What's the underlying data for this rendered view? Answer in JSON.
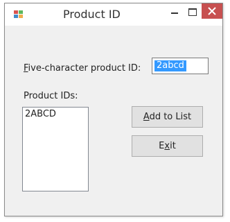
{
  "window": {
    "title": "Product ID"
  },
  "form": {
    "pid_label": {
      "first": "F",
      "rest": "ive-character product ID:"
    },
    "pid_value": "2abcd",
    "list_label": "Product IDs:",
    "list_items": [
      "2ABCD"
    ],
    "add_button": {
      "first": "A",
      "rest": "dd to List"
    },
    "exit_button": {
      "pre": "E",
      "mn": "x",
      "post": "it"
    }
  }
}
